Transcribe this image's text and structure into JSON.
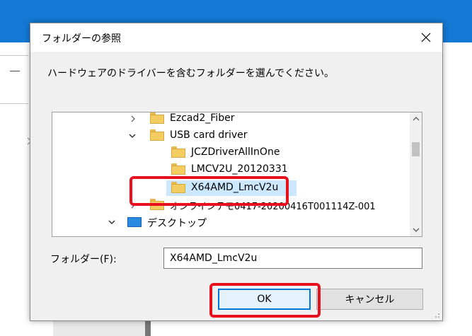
{
  "dialog": {
    "title": "フォルダーの参照",
    "instruction": "ハードウェアのドライバーを含むフォルダーを選んでください。",
    "close_icon": "close-icon"
  },
  "tree": {
    "items": [
      {
        "label": "Ezcad2_Fiber",
        "expander": "chevron-right",
        "icon": "folder-icon"
      },
      {
        "label": "USB card driver",
        "expander": "chevron-down",
        "icon": "folder-icon"
      },
      {
        "label": "JCZDriverAllInOne",
        "expander": "",
        "icon": "folder-icon"
      },
      {
        "label": "LMCV2U_20120331",
        "expander": "",
        "icon": "folder-icon"
      },
      {
        "label": "X64AMD_LmcV2u",
        "expander": "",
        "icon": "folder-icon",
        "selected": true
      },
      {
        "label": "オンラインテモ0417-20200416T001114Z-001",
        "expander": "chevron-right",
        "icon": "folder-icon"
      },
      {
        "label": "デスクトップ",
        "expander": "chevron-down",
        "icon": "desktop-icon"
      }
    ]
  },
  "folder_field": {
    "label": "フォルダー(F):",
    "value": "X64AMD_LmcV2u"
  },
  "buttons": {
    "ok": "OK",
    "cancel": "キャンセル"
  },
  "colors": {
    "highlight": "#e8101c",
    "selection": "#cce8ff",
    "accent": "#0078d7"
  }
}
